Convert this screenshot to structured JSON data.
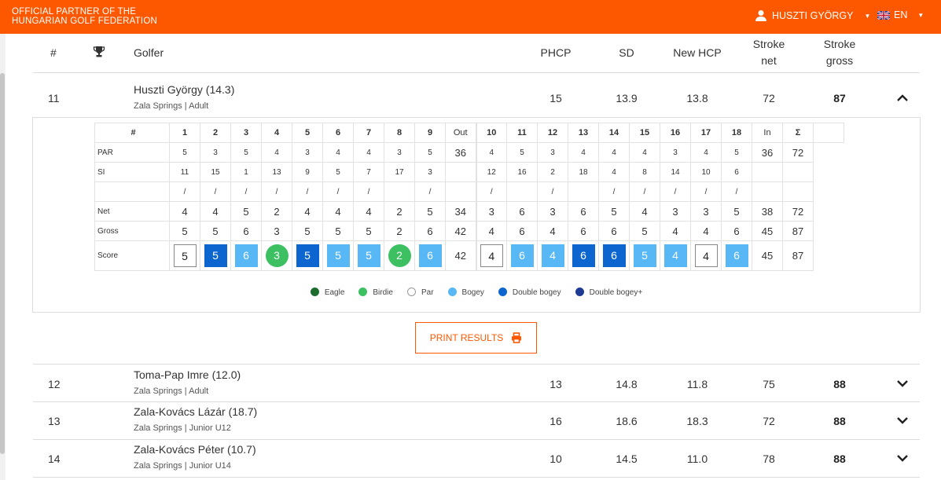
{
  "topbar": {
    "partner_line1": "OFFICIAL PARTNER OF THE",
    "partner_line2": "HUNGARIAN GOLF FEDERATION",
    "user_name": "HUSZTI GYÖRGY",
    "lang": "EN",
    "color": "#fd5800"
  },
  "header": {
    "num": "#",
    "golfer": "Golfer",
    "phcp": "PHCP",
    "sd": "SD",
    "new_hcp": "New HCP",
    "stroke_net_1": "Stroke",
    "stroke_net_2": "net",
    "stroke_gross_1": "Stroke",
    "stroke_gross_2": "gross"
  },
  "rows": [
    {
      "pos": "11",
      "name": "Huszti György (14.3)",
      "sub": "Zala Springs | Adult",
      "phcp": "15",
      "sd": "13.9",
      "new_hcp": "13.8",
      "net": "72",
      "gross": "87"
    },
    {
      "pos": "12",
      "name": "Toma-Pap Imre (12.0)",
      "sub": "Zala Springs | Adult",
      "phcp": "13",
      "sd": "14.8",
      "new_hcp": "11.8",
      "net": "75",
      "gross": "88"
    },
    {
      "pos": "13",
      "name": "Zala-Kovács Lázár (18.7)",
      "sub": "Zala Springs | Junior U12",
      "phcp": "16",
      "sd": "18.6",
      "new_hcp": "18.3",
      "net": "72",
      "gross": "88"
    },
    {
      "pos": "14",
      "name": "Zala-Kovács Péter (10.7)",
      "sub": "Zala Springs | Junior U14",
      "phcp": "10",
      "sd": "14.5",
      "new_hcp": "11.0",
      "net": "78",
      "gross": "88"
    }
  ],
  "scorecard": {
    "hash": "#",
    "out": "Out",
    "in": "In",
    "sigma": "Σ",
    "holes_front": [
      "1",
      "2",
      "3",
      "4",
      "5",
      "6",
      "7",
      "8",
      "9"
    ],
    "holes_back": [
      "10",
      "11",
      "12",
      "13",
      "14",
      "15",
      "16",
      "17",
      "18"
    ],
    "labels": {
      "par": "PAR",
      "si": "SI",
      "net": "Net",
      "gross": "Gross",
      "score": "Score"
    },
    "par_front": [
      "5",
      "3",
      "5",
      "4",
      "3",
      "4",
      "4",
      "3",
      "5"
    ],
    "par_out": "36",
    "par_back": [
      "4",
      "5",
      "3",
      "4",
      "4",
      "4",
      "3",
      "4",
      "5"
    ],
    "par_in": "36",
    "par_total": "72",
    "si_front": [
      "11",
      "15",
      "1",
      "13",
      "9",
      "5",
      "7",
      "17",
      "3"
    ],
    "si_back": [
      "12",
      "16",
      "2",
      "18",
      "4",
      "8",
      "14",
      "10",
      "6"
    ],
    "slash_front": [
      "/",
      "/",
      "/",
      "/",
      "/",
      "/",
      "/",
      "",
      "/"
    ],
    "slash_back": [
      "/",
      "",
      "/",
      "",
      "/",
      "/",
      "/",
      "/",
      "/"
    ],
    "net_front": [
      "4",
      "4",
      "5",
      "2",
      "4",
      "4",
      "4",
      "2",
      "5"
    ],
    "net_out": "34",
    "net_back": [
      "3",
      "6",
      "3",
      "6",
      "5",
      "4",
      "3",
      "3",
      "5"
    ],
    "net_in": "38",
    "net_total": "72",
    "gross_front": [
      "5",
      "5",
      "6",
      "3",
      "5",
      "5",
      "5",
      "2",
      "6"
    ],
    "gross_out": "42",
    "gross_back": [
      "4",
      "6",
      "4",
      "6",
      "6",
      "5",
      "4",
      "4",
      "6"
    ],
    "gross_in": "45",
    "gross_total": "87",
    "score_front": [
      {
        "v": "5",
        "t": "par"
      },
      {
        "v": "5",
        "t": "dbogey"
      },
      {
        "v": "6",
        "t": "bogey"
      },
      {
        "v": "3",
        "t": "birdie"
      },
      {
        "v": "5",
        "t": "dbogey"
      },
      {
        "v": "5",
        "t": "bogey"
      },
      {
        "v": "5",
        "t": "bogey"
      },
      {
        "v": "2",
        "t": "birdie"
      },
      {
        "v": "6",
        "t": "bogey"
      }
    ],
    "score_out": "42",
    "score_back": [
      {
        "v": "4",
        "t": "par"
      },
      {
        "v": "6",
        "t": "bogey"
      },
      {
        "v": "4",
        "t": "bogey"
      },
      {
        "v": "6",
        "t": "dbogey"
      },
      {
        "v": "6",
        "t": "dbogey"
      },
      {
        "v": "5",
        "t": "bogey"
      },
      {
        "v": "4",
        "t": "bogey"
      },
      {
        "v": "4",
        "t": "par"
      },
      {
        "v": "6",
        "t": "bogey"
      }
    ],
    "score_in": "45",
    "score_total": "87"
  },
  "legend": [
    {
      "label": "Eagle",
      "color": "#1d6b2d"
    },
    {
      "label": "Birdie",
      "color": "#3cc062"
    },
    {
      "label": "Par",
      "color": "#ffffff"
    },
    {
      "label": "Bogey",
      "color": "#58b7f5"
    },
    {
      "label": "Double bogey",
      "color": "#0d66d0"
    },
    {
      "label": "Double bogey+",
      "color": "#1f3a93"
    }
  ],
  "print_label": "PRINT RESULTS"
}
